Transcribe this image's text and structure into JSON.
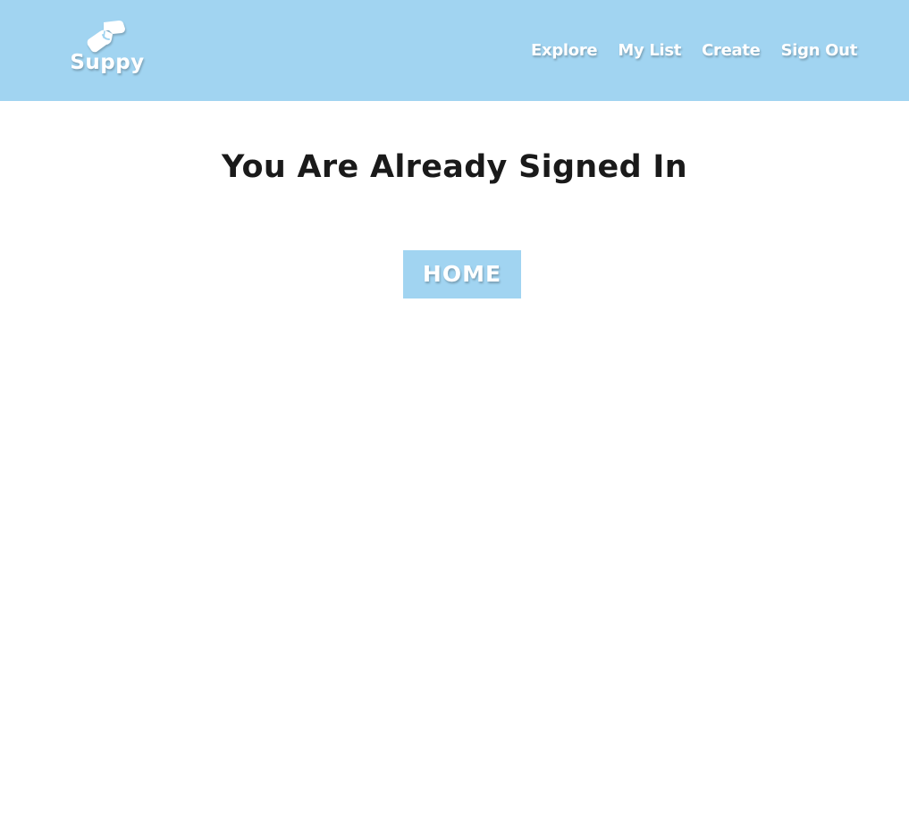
{
  "header": {
    "brand": {
      "icon": "handshake-icon",
      "name": "Suppy"
    },
    "nav": [
      {
        "label": "Explore"
      },
      {
        "label": "My List"
      },
      {
        "label": "Create"
      },
      {
        "label": "Sign Out"
      }
    ]
  },
  "main": {
    "title": "You Are Already Signed In",
    "home_button_label": "HOME"
  },
  "colors": {
    "navbar_bg": "#a1d4f1",
    "button_bg": "#a1d4f1",
    "nav_text": "#ffffff",
    "title_text": "#1a1a1a"
  }
}
